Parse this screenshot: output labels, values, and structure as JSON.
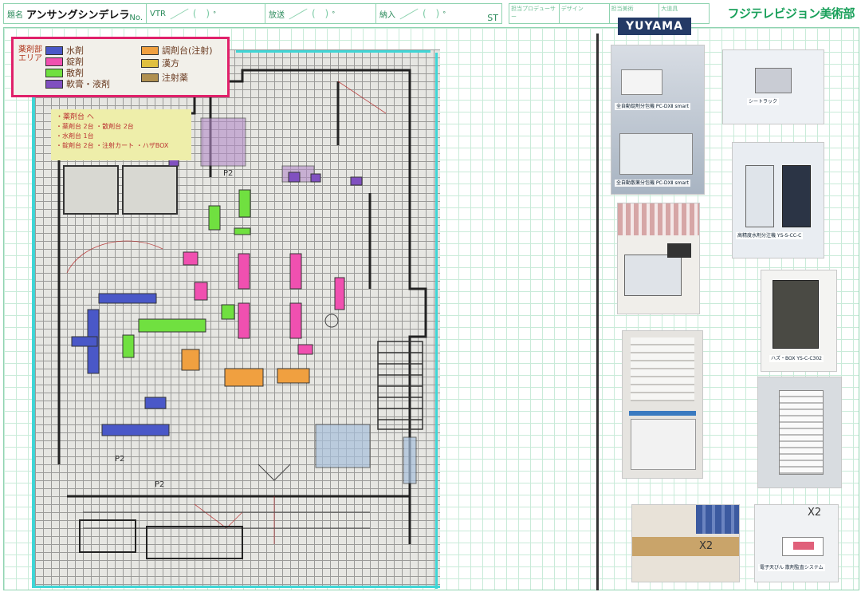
{
  "header": {
    "title_label": "題名",
    "title": "アンサングシンデレラ",
    "no_label": "No.",
    "vtr_label": "VTR",
    "broadcast_label": "放送",
    "delivery_label": "納入",
    "paren": "( )",
    "deg": "°",
    "st_label": "ST"
  },
  "header2": {
    "cells": [
      "担当プロデューサー",
      "デザイン",
      "担当美術",
      "大道具"
    ]
  },
  "brand": "フジテレビジョン美術部",
  "legend": {
    "side_note": "薬剤部 エリア",
    "items": [
      {
        "label": "水剤",
        "color": "#4a58c8"
      },
      {
        "label": "調剤台(注射)",
        "color": "#f0a040"
      },
      {
        "label": "錠剤",
        "color": "#f050b0"
      },
      {
        "label": "漢方",
        "color": "#e0c040"
      },
      {
        "label": "散剤",
        "color": "#70e040"
      },
      {
        "label": "注射薬",
        "color": "#b09050"
      },
      {
        "label": "軟膏・液剤",
        "color": "#8050c0"
      }
    ]
  },
  "note": {
    "title": "・薬剤台 へ",
    "lines": [
      "・薬剤台 2台 ・散剤台 2台",
      "・水剤台 1台",
      "・錠剤台 2台 ・注射カート ・ハザBOX"
    ]
  },
  "plan_labels": {
    "p1": "P2",
    "p2": "P2",
    "p3": "P2"
  },
  "photos": {
    "yuyama_logo": "YUYAMA",
    "p1_cap": "全自動錠剤分包機 PC-DXⅡ smart",
    "p1b_cap": "全自動散薬分包機 PC-DXⅡ smart",
    "p2_cap": "シートラック",
    "p3_cap": "高精度水剤分注機 YS-S-CC-C",
    "p4_cap": "ハズ・BOX YS-C-C302",
    "p7_cap": "電子天びん 散剤監査システム",
    "p6_mark": "X2",
    "p8_mark": "X2"
  }
}
